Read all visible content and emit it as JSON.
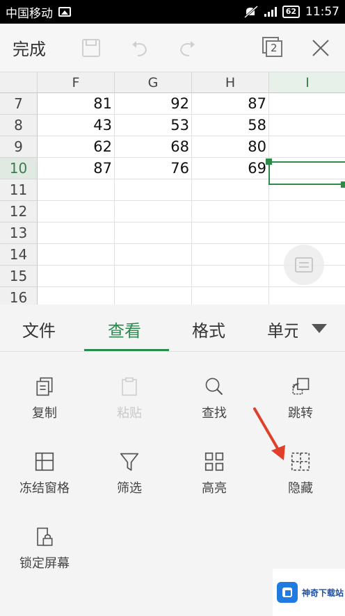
{
  "status_bar": {
    "carrier": "中国移动",
    "battery": "62",
    "time": "11:57"
  },
  "toolbar": {
    "done_label": "完成",
    "window_count": "2"
  },
  "sheet": {
    "columns": [
      "F",
      "G",
      "H",
      "I"
    ],
    "rows": [
      "7",
      "8",
      "9",
      "10",
      "11",
      "12",
      "13",
      "14",
      "15",
      "16"
    ],
    "cells": [
      [
        "81",
        "92",
        "87"
      ],
      [
        "43",
        "53",
        "58"
      ],
      [
        "62",
        "68",
        "80"
      ],
      [
        "87",
        "76",
        "69"
      ]
    ]
  },
  "tabs": [
    "文件",
    "查看",
    "格式",
    "单元"
  ],
  "menu": {
    "copy": "复制",
    "paste": "粘贴",
    "find": "查找",
    "jump": "跳转",
    "freeze": "冻结窗格",
    "filter": "筛选",
    "highlight": "高亮",
    "hide": "隐藏",
    "lock_screen": "锁定屏幕"
  },
  "watermark": {
    "text": "神奇下载站"
  },
  "colors": {
    "accent": "#2b8a4d",
    "annotation_arrow": "#e0402a"
  }
}
